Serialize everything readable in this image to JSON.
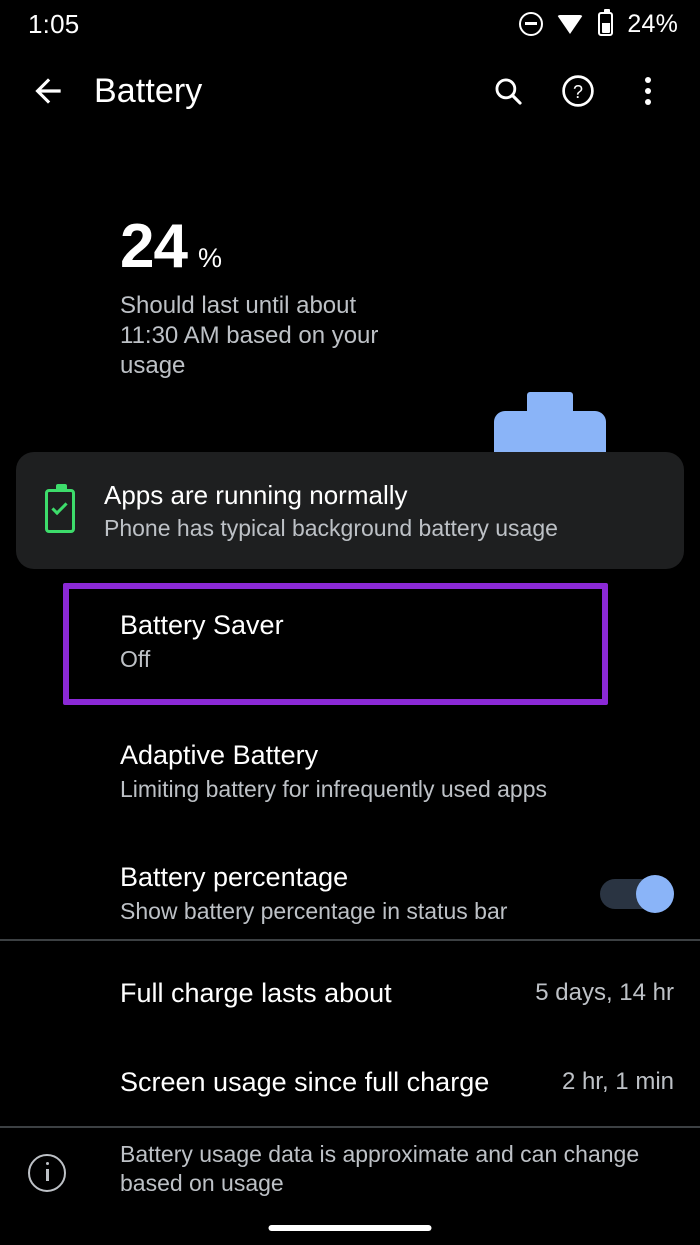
{
  "status_bar": {
    "time": "1:05",
    "battery_percent": "24%",
    "icons": [
      "do-not-disturb-icon",
      "wifi-icon",
      "battery-icon"
    ]
  },
  "app_bar": {
    "title": "Battery",
    "back_icon": "back-arrow-icon",
    "search_icon": "search-icon",
    "help_icon": "help-icon",
    "overflow_icon": "overflow-menu-icon"
  },
  "summary": {
    "percent_value": "24",
    "percent_sign": "%",
    "estimate": "Should last until about 11:30 AM based on your usage"
  },
  "status_card": {
    "icon": "battery-check-icon",
    "title": "Apps are running normally",
    "subtitle": "Phone has typical background battery usage"
  },
  "preferences": [
    {
      "title": "Battery Saver",
      "subtitle": "Off",
      "highlighted": true
    },
    {
      "title": "Adaptive Battery",
      "subtitle": "Limiting battery for infrequently used apps",
      "highlighted": false
    },
    {
      "title": "Battery percentage",
      "subtitle": "Show battery percentage in status bar",
      "highlighted": false,
      "toggle_state": "on"
    }
  ],
  "info_rows": [
    {
      "label": "Full charge lasts about",
      "value": "5 days, 14 hr"
    },
    {
      "label": "Screen usage since full charge",
      "value": "2 hr, 1 min"
    }
  ],
  "footer": {
    "icon": "info-icon",
    "text": "Battery usage data is approximate and can change based on usage"
  },
  "colors": {
    "background": "#000000",
    "card_background": "#1e1f20",
    "accent_blue": "#8ab4f8",
    "accent_green": "#3ddc6b",
    "highlight_purple": "#8b29d6",
    "secondary_text": "#bdc1c6",
    "divider": "#3c4043"
  }
}
